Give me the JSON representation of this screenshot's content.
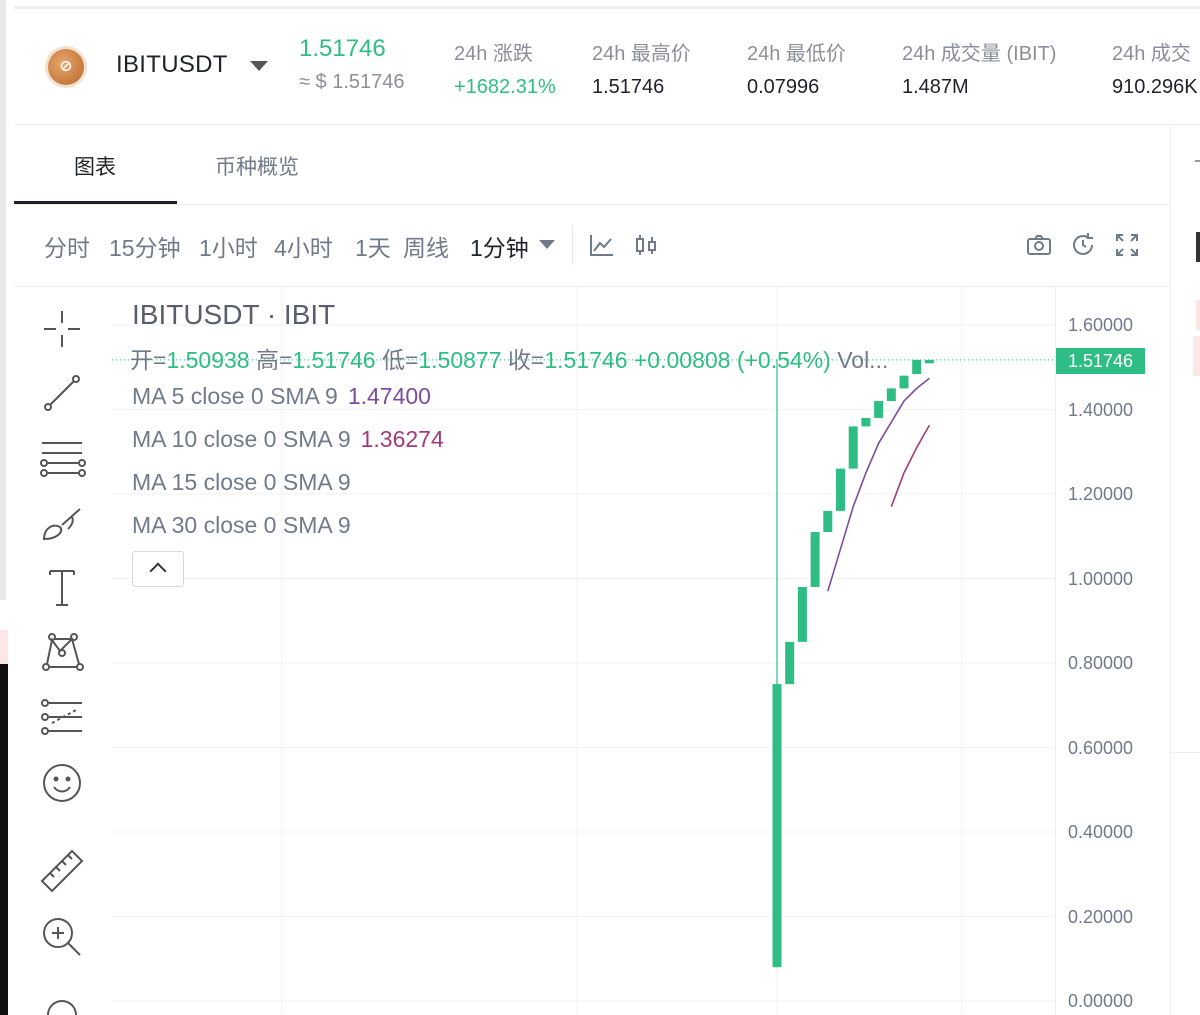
{
  "header": {
    "coin_icon": "coin-logo-icon",
    "symbol": "IBITUSDT",
    "price": "1.51746",
    "price_usd": "≈ $ 1.51746",
    "stats": [
      {
        "label": "24h 涨跌",
        "value": "+1682.31%",
        "positive": true
      },
      {
        "label": "24h 最高价",
        "value": "1.51746"
      },
      {
        "label": "24h 最低价",
        "value": "0.07996"
      },
      {
        "label": "24h 成交量 (IBIT)",
        "value": "1.487M"
      },
      {
        "label": "24h 成交",
        "value": "910.296K"
      }
    ]
  },
  "tabs": [
    {
      "label": "图表",
      "active": true
    },
    {
      "label": "币种概览",
      "active": false
    }
  ],
  "toolbar": {
    "timeframes": [
      "分时",
      "15分钟",
      "1小时",
      "4小时",
      "1天",
      "周线",
      "1分钟"
    ],
    "active_timeframe": "1分钟",
    "icons": [
      "line-chart-icon",
      "candlestick-icon",
      "camera-icon",
      "refresh-icon",
      "fullscreen-icon"
    ]
  },
  "drawing_tools": [
    "crosshair-icon",
    "trend-line-icon",
    "horizontal-lines-icon",
    "brush-icon",
    "text-icon",
    "pattern-icon",
    "fib-icon",
    "emoji-icon",
    "ruler-icon",
    "zoom-in-icon"
  ],
  "legend": {
    "title": "IBITUSDT · IBIT",
    "open_label": "开=",
    "open": "1.50938",
    "high_label": "高=",
    "high": "1.51746",
    "low_label": "低=",
    "low": "1.50877",
    "close_label": "收=",
    "close": "1.51746",
    "change": "+0.00808 (+0.54%)",
    "vol": "Vol...",
    "ma": [
      {
        "label": "MA 5 close 0 SMA 9",
        "value": "1.47400"
      },
      {
        "label": "MA 10 close 0 SMA 9",
        "value": "1.36274"
      },
      {
        "label": "MA 15 close 0 SMA 9",
        "value": ""
      },
      {
        "label": "MA 30 close 0 SMA 9",
        "value": ""
      }
    ]
  },
  "colors": {
    "up": "#2ebd85",
    "ma5": "#7b4da0",
    "ma10": "#a33a7a",
    "axis_text": "#707a8a"
  },
  "chart_data": {
    "type": "candlestick",
    "ylim": [
      0,
      1.6
    ],
    "y_ticks": [
      "1.60000",
      "1.40000",
      "1.20000",
      "1.00000",
      "0.80000",
      "0.60000",
      "0.40000",
      "0.20000",
      "0.00000"
    ],
    "last_price": "1.51746",
    "candles": [
      {
        "open": 0.08,
        "high": 1.5175,
        "low": 0.08,
        "close": 0.75
      },
      {
        "open": 0.75,
        "high": 0.85,
        "low": 0.75,
        "close": 0.85
      },
      {
        "open": 0.85,
        "high": 0.98,
        "low": 0.85,
        "close": 0.98
      },
      {
        "open": 0.98,
        "high": 1.11,
        "low": 0.98,
        "close": 1.11
      },
      {
        "open": 1.11,
        "high": 1.16,
        "low": 1.11,
        "close": 1.16
      },
      {
        "open": 1.16,
        "high": 1.26,
        "low": 1.16,
        "close": 1.26
      },
      {
        "open": 1.26,
        "high": 1.36,
        "low": 1.26,
        "close": 1.36
      },
      {
        "open": 1.36,
        "high": 1.38,
        "low": 1.36,
        "close": 1.38
      },
      {
        "open": 1.38,
        "high": 1.42,
        "low": 1.38,
        "close": 1.42
      },
      {
        "open": 1.42,
        "high": 1.45,
        "low": 1.42,
        "close": 1.45
      },
      {
        "open": 1.45,
        "high": 1.48,
        "low": 1.45,
        "close": 1.48
      },
      {
        "open": 1.4838,
        "high": 1.5175,
        "low": 1.4838,
        "close": 1.5175
      },
      {
        "open": 1.5094,
        "high": 1.5175,
        "low": 1.5088,
        "close": 1.5175
      }
    ],
    "ma5": [
      null,
      null,
      null,
      null,
      0.97,
      1.07,
      1.17,
      1.25,
      1.32,
      1.37,
      1.42,
      1.45,
      1.474
    ],
    "ma10": [
      null,
      null,
      null,
      null,
      null,
      null,
      null,
      null,
      null,
      1.17,
      1.25,
      1.31,
      1.3627
    ]
  }
}
